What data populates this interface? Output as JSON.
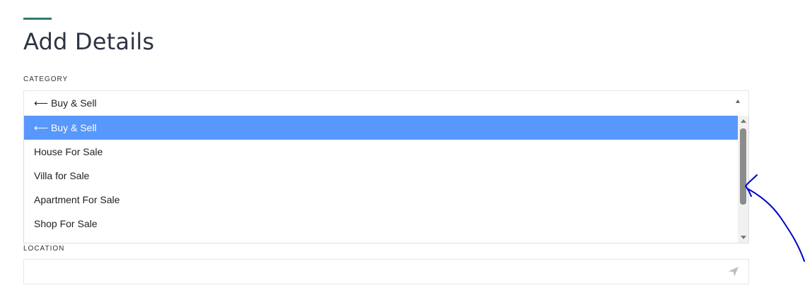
{
  "page": {
    "title": "Add Details"
  },
  "category": {
    "label": "CATEGORY",
    "selected_value": "⟵ Buy & Sell",
    "options": [
      "⟵ Buy & Sell",
      "House For Sale",
      "Villa for Sale",
      "Apartment For Sale",
      "Shop For Sale"
    ]
  },
  "location": {
    "label": "LOCATION",
    "value": "",
    "placeholder": ""
  },
  "icons": {
    "select_caret": "caret-up-icon",
    "location_button": "navigation-arrow-icon"
  },
  "colors": {
    "accent": "#2e7d6b",
    "highlight": "#5897fb",
    "annotation": "#0000cc"
  }
}
